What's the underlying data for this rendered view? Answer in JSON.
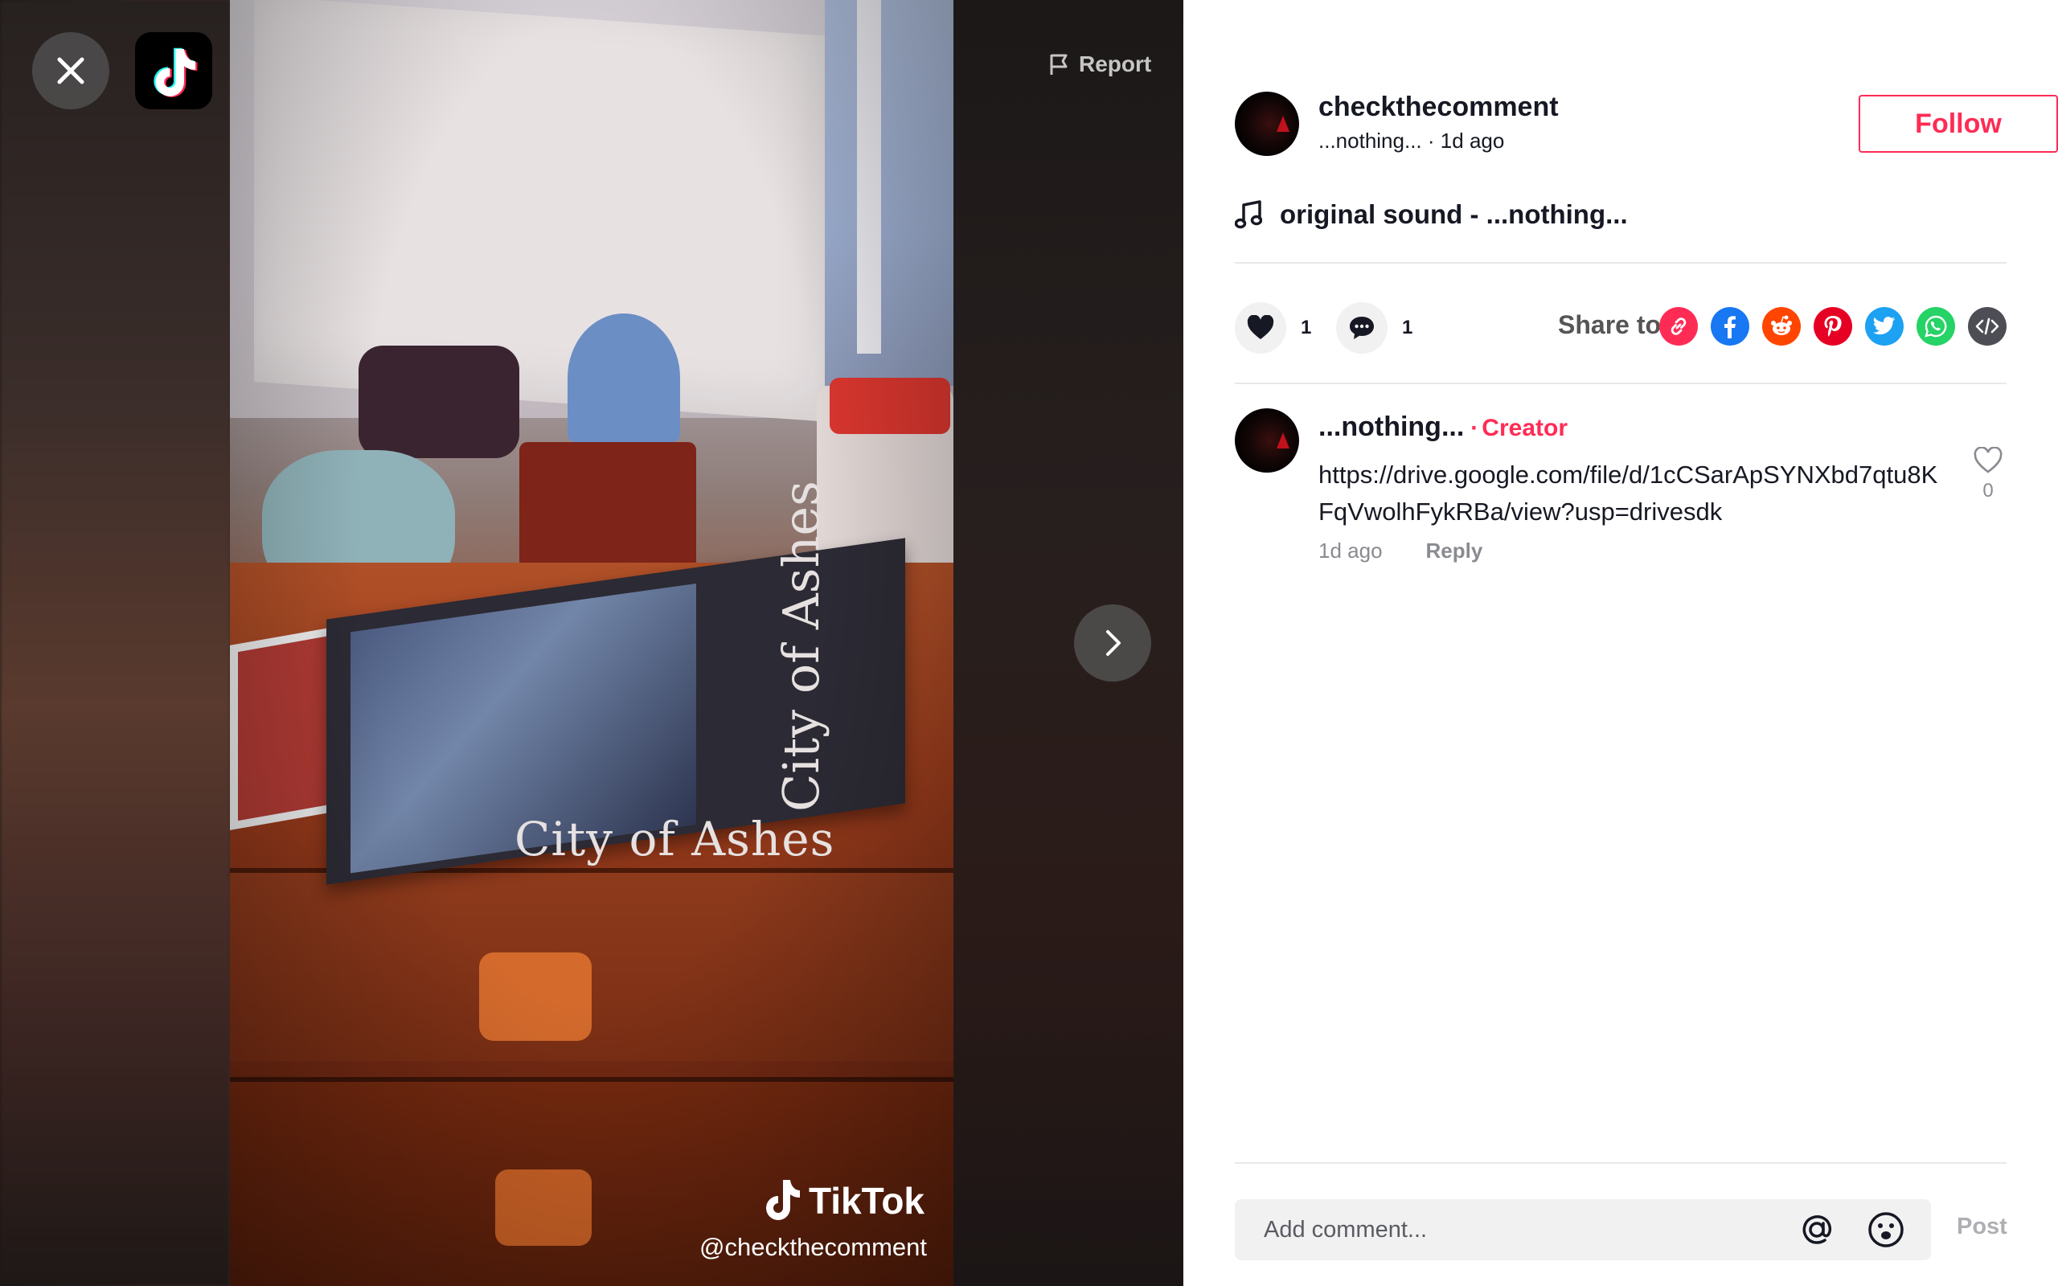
{
  "top": {
    "report_label": "Report"
  },
  "video": {
    "book_title": "City of Ashes",
    "watermark_logo": "TikTok",
    "watermark_handle": "@checkthecomment"
  },
  "author": {
    "username": "checkthecomment",
    "nickname": "...nothing...",
    "separator": "·",
    "time": "1d ago",
    "follow_label": "Follow"
  },
  "music": {
    "text": "original sound - ...nothing..."
  },
  "actions": {
    "likes": "1",
    "comments": "1",
    "share_label": "Share to",
    "share_icons": [
      "link-icon",
      "facebook-icon",
      "reddit-icon",
      "pinterest-icon",
      "twitter-icon",
      "whatsapp-icon",
      "embed-icon"
    ]
  },
  "comments": [
    {
      "username": "...nothing...",
      "dot": "·",
      "badge": "Creator",
      "text": "https://drive.google.com/file/d/1cCSarApSYNXbd7qtu8KFqVwolhFykRBa/view?usp=drivesdk",
      "time": "1d ago",
      "reply_label": "Reply",
      "like_count": "0"
    }
  ],
  "composer": {
    "placeholder": "Add comment...",
    "post_label": "Post"
  },
  "colors": {
    "accent": "#fe2c55",
    "text": "#161823",
    "muted": "#8a8b91"
  }
}
